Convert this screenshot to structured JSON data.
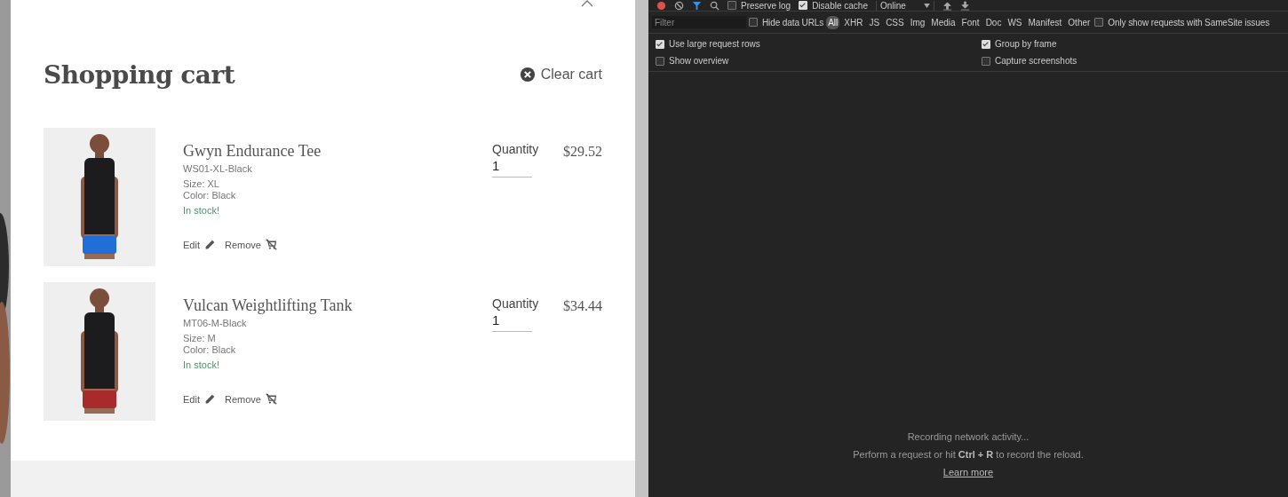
{
  "cart": {
    "title": "Shopping cart",
    "clear_label": "Clear cart",
    "items": [
      {
        "name": "Gwyn Endurance Tee",
        "sku": "WS01-XL-Black",
        "size": "Size: XL",
        "color_label": "Color: Black",
        "stock": "In stock!",
        "quantity_label": "Quantity",
        "quantity": "1",
        "price": "$29.52",
        "edit": "Edit",
        "remove": "Remove"
      },
      {
        "name": "Vulcan Weightlifting Tank",
        "sku": "MT06-M-Black",
        "size": "Size: M",
        "color_label": "Color: Black",
        "stock": "In stock!",
        "quantity_label": "Quantity",
        "quantity": "1",
        "price": "$34.44",
        "edit": "Edit",
        "remove": "Remove"
      }
    ]
  },
  "devtools": {
    "toolbar": {
      "preserve_log": {
        "label": "Preserve log",
        "checked": false
      },
      "disable_cache": {
        "label": "Disable cache",
        "checked": true
      },
      "throttling": "Online"
    },
    "filter": {
      "placeholder": "Filter",
      "hide_data_urls": {
        "label": "Hide data URLs",
        "checked": false
      },
      "types": [
        {
          "label": "All",
          "selected": true
        },
        {
          "label": "XHR",
          "selected": false
        },
        {
          "label": "JS",
          "selected": false
        },
        {
          "label": "CSS",
          "selected": false
        },
        {
          "label": "Img",
          "selected": false
        },
        {
          "label": "Media",
          "selected": false
        },
        {
          "label": "Font",
          "selected": false
        },
        {
          "label": "Doc",
          "selected": false
        },
        {
          "label": "WS",
          "selected": false
        },
        {
          "label": "Manifest",
          "selected": false
        },
        {
          "label": "Other",
          "selected": false
        }
      ],
      "samesite": {
        "label": "Only show requests with SameSite issues",
        "checked": false
      }
    },
    "settings": [
      {
        "label": "Use large request rows",
        "checked": true
      },
      {
        "label": "Group by frame",
        "checked": true
      },
      {
        "label": "Show overview",
        "checked": false
      },
      {
        "label": "Capture screenshots",
        "checked": false
      }
    ],
    "empty": {
      "title": "Recording network activity...",
      "hint": "Perform a request or hit **Ctrl + R** to record the reload.",
      "link": "Learn more"
    }
  }
}
